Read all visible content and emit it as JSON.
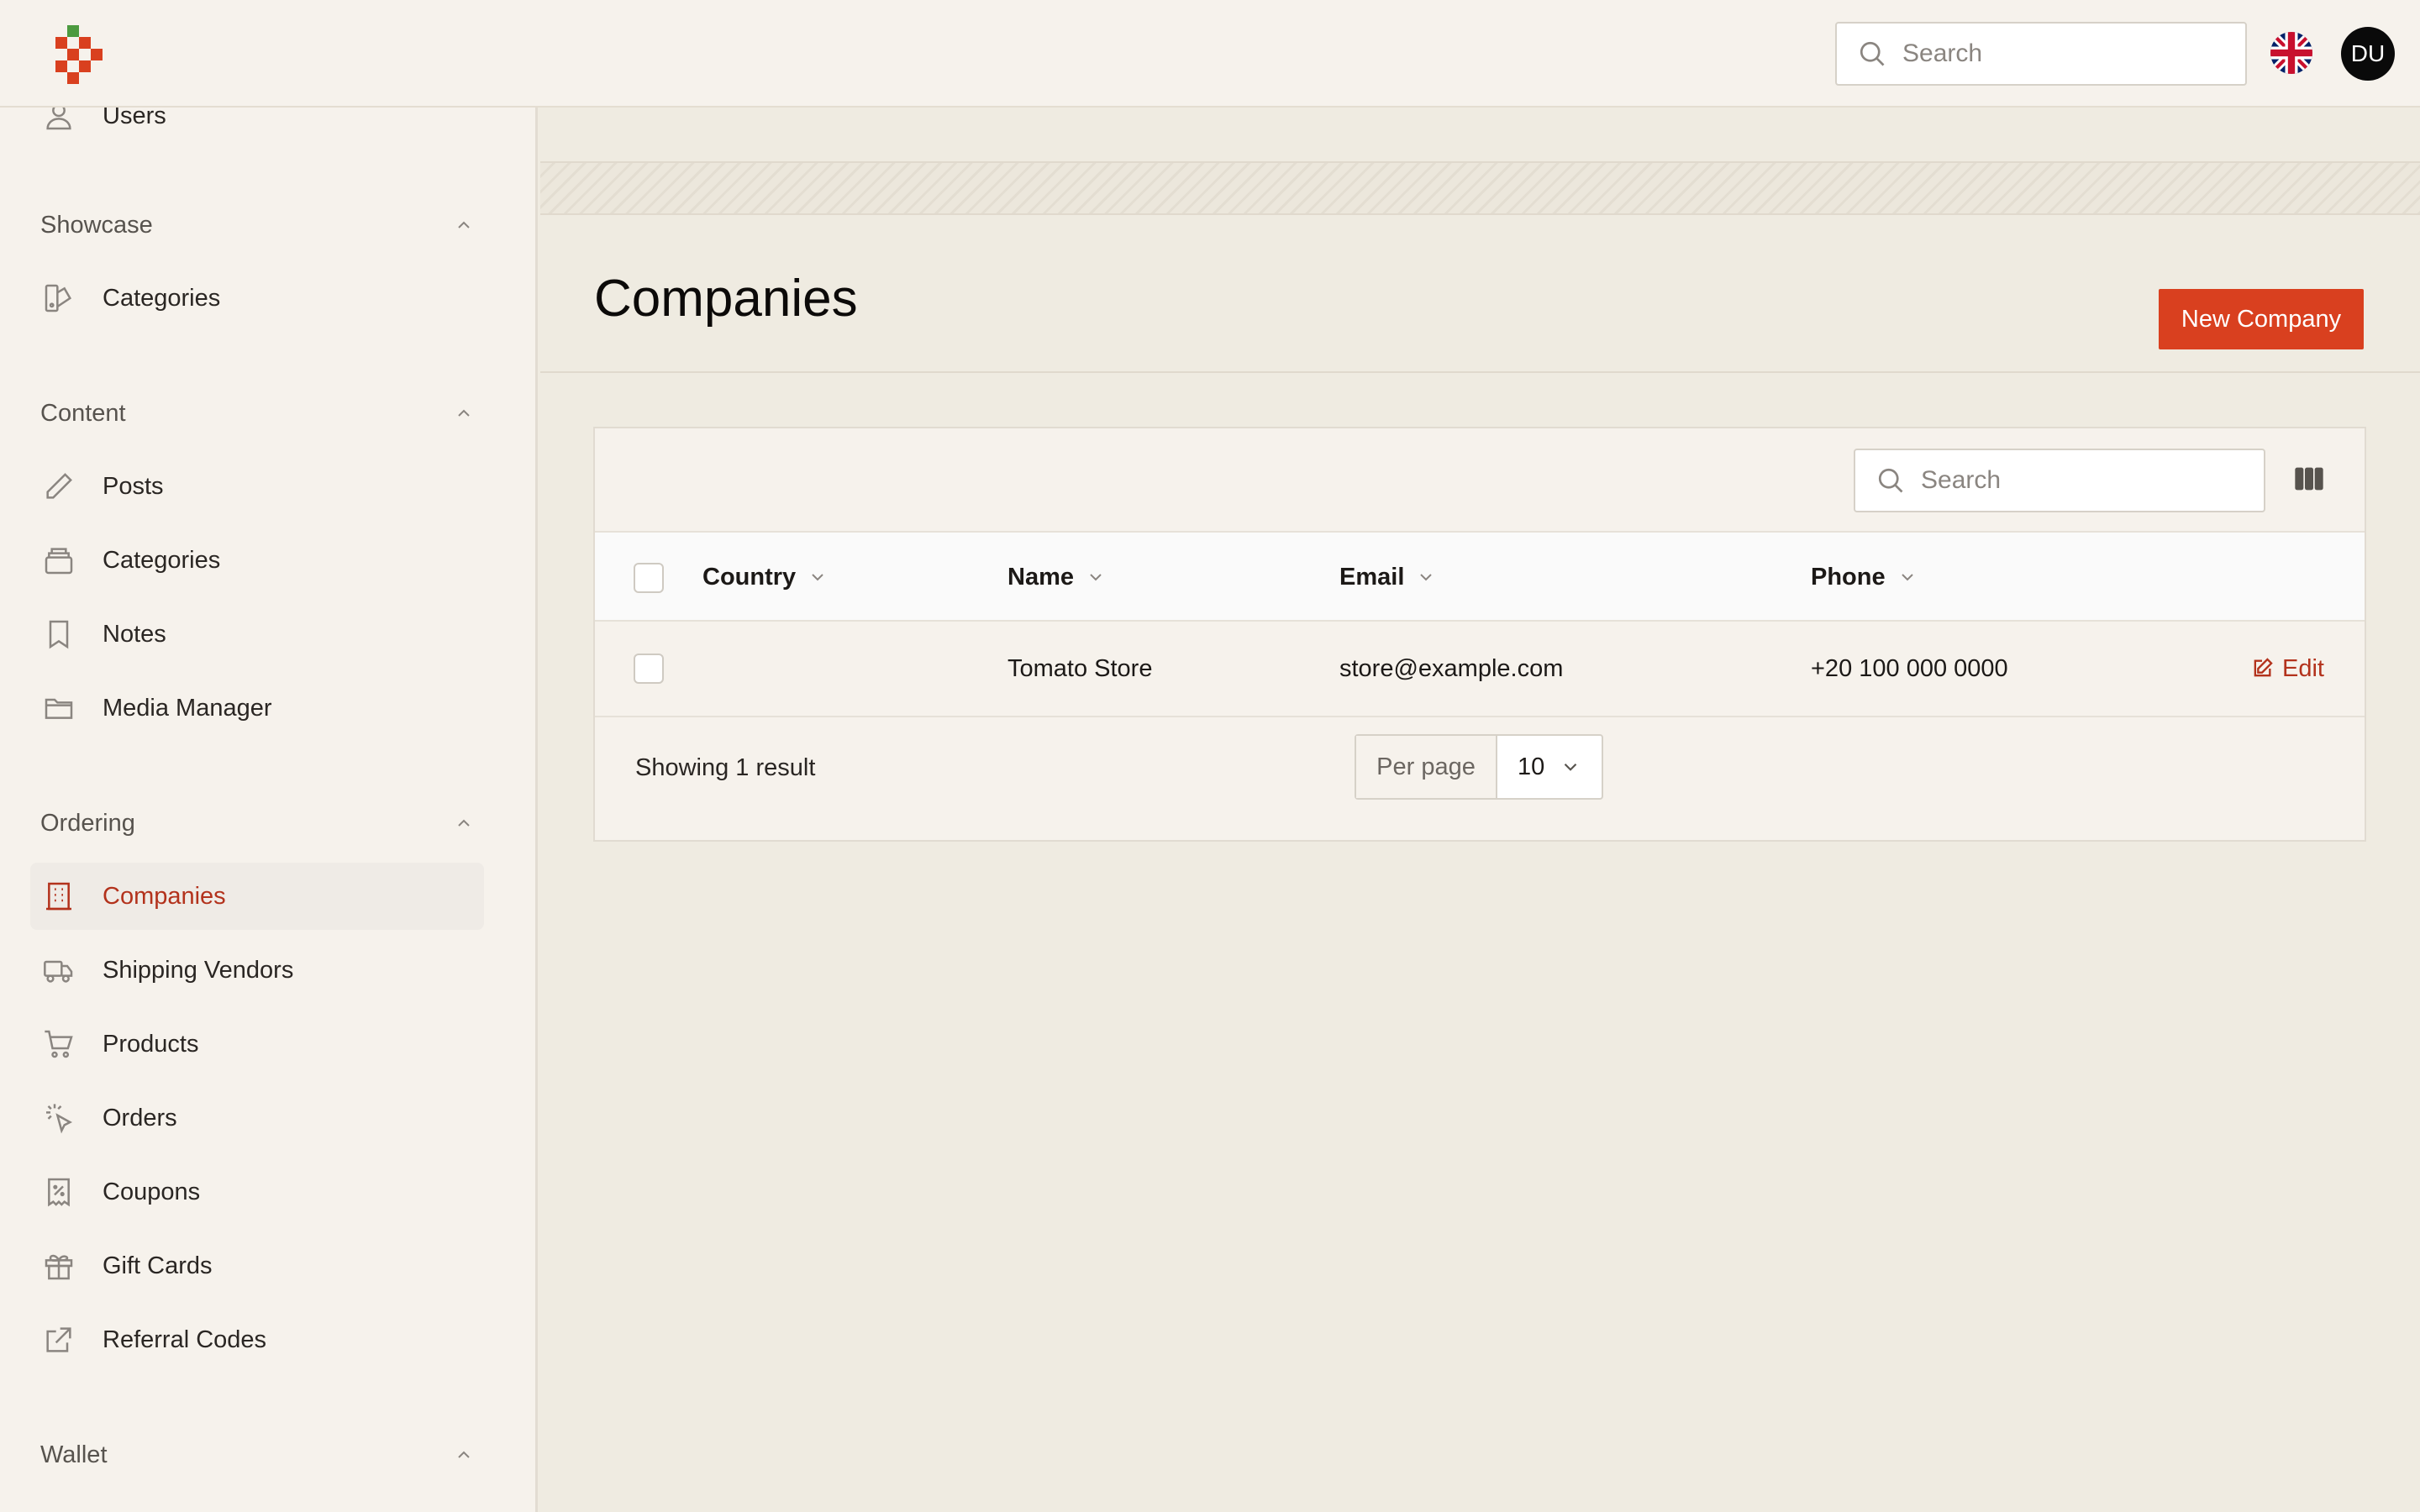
{
  "topbar": {
    "search_placeholder": "Search",
    "language_icon": "uk-flag-icon",
    "avatar_initials": "DU"
  },
  "sidebar": {
    "partial_item": {
      "label": "Users",
      "icon": "user-icon"
    },
    "groups": [
      {
        "title": "Showcase",
        "items": [
          {
            "label": "Categories",
            "icon": "swatch-icon"
          }
        ]
      },
      {
        "title": "Content",
        "items": [
          {
            "label": "Posts",
            "icon": "pencil-icon"
          },
          {
            "label": "Categories",
            "icon": "stack-icon"
          },
          {
            "label": "Notes",
            "icon": "bookmark-icon"
          },
          {
            "label": "Media Manager",
            "icon": "folder-icon"
          }
        ]
      },
      {
        "title": "Ordering",
        "items": [
          {
            "label": "Companies",
            "icon": "building-icon",
            "active": true
          },
          {
            "label": "Shipping Vendors",
            "icon": "truck-icon"
          },
          {
            "label": "Products",
            "icon": "cart-icon"
          },
          {
            "label": "Orders",
            "icon": "cursor-click-icon"
          },
          {
            "label": "Coupons",
            "icon": "receipt-percent-icon"
          },
          {
            "label": "Gift Cards",
            "icon": "gift-icon"
          },
          {
            "label": "Referral Codes",
            "icon": "external-link-icon"
          }
        ]
      },
      {
        "title": "Wallet",
        "items": []
      }
    ]
  },
  "page": {
    "title": "Companies",
    "new_button": "New Company"
  },
  "table": {
    "search_placeholder": "Search",
    "columns": [
      "Country",
      "Name",
      "Email",
      "Phone"
    ],
    "rows": [
      {
        "country": "",
        "name": "Tomato Store",
        "email": "store@example.com",
        "phone": "+20 100 000 0000",
        "action": "Edit"
      }
    ],
    "footer": {
      "showing": "Showing 1 result",
      "per_page_label": "Per page",
      "per_page_value": "10"
    }
  },
  "colors": {
    "accent": "#d9401f",
    "accent_text": "#b3321c",
    "background": "#efebe1",
    "panel": "#f6f2ec"
  }
}
